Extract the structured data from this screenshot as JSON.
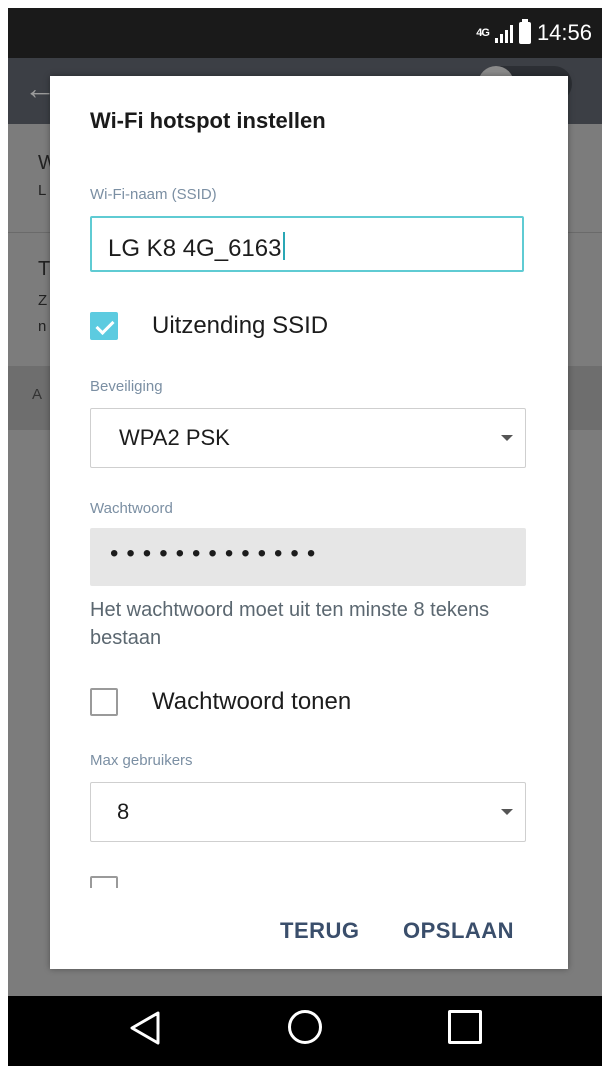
{
  "status_bar": {
    "network": "4G",
    "time": "14:56"
  },
  "background": {
    "letters": [
      "W",
      "L",
      "T",
      "Z",
      "n",
      "A"
    ]
  },
  "dialog": {
    "title": "Wi-Fi hotspot instellen",
    "ssid": {
      "label": "Wi-Fi-naam (SSID)",
      "value": "LG K8 4G_6163"
    },
    "broadcast_ssid": {
      "label": "Uitzending SSID",
      "checked": true
    },
    "security": {
      "label": "Beveiliging",
      "value": "WPA2 PSK"
    },
    "password": {
      "label": "Wachtwoord",
      "masked": "•••••••••••••"
    },
    "helper": "Het wachtwoord moet uit ten minste 8 tekens bestaan",
    "show_password": {
      "label": "Wachtwoord tonen",
      "checked": false
    },
    "max_users": {
      "label": "Max gebruikers",
      "value": "8"
    },
    "cancel_label": "TERUG",
    "save_label": "OPSLAAN"
  },
  "colors": {
    "accent": "#5ccbe0",
    "button_text": "#3a4e6b",
    "label": "#7b8fa3"
  }
}
